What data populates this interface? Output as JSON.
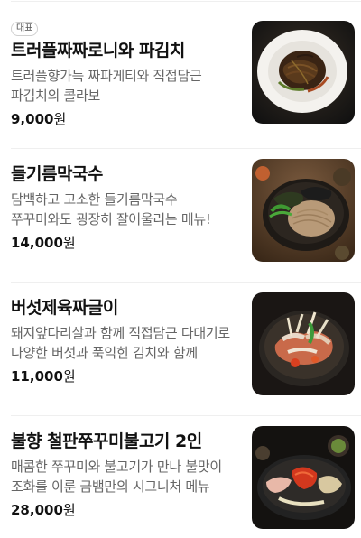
{
  "menu": {
    "items": [
      {
        "badge": "대표",
        "name": "트러플짜짜로니와 파김치",
        "description": "트러플향가득 짜파게티와 직접담근 파김치의 콜라보",
        "price_number": "9,000",
        "price_unit": "원"
      },
      {
        "name": "들기름막국수",
        "description": "담백하고 고소한 들기름막국수 쭈꾸미와도 굉장히 잘어울리는 메뉴!",
        "price_number": "14,000",
        "price_unit": "원"
      },
      {
        "name": "버섯제육짜글이",
        "description": "돼지앞다리살과 함께 직접담근 다대기로 다양한 버섯과 푹익힌 김치와 함께",
        "price_number": "11,000",
        "price_unit": "원"
      },
      {
        "name": "불향 철판쭈꾸미불고기 2인",
        "description": "매콤한 쭈꾸미와 불고기가 만나 불맛이 조화를 이룬 금뱀만의 시그니처 메뉴",
        "price_number": "28,000",
        "price_unit": "원"
      }
    ]
  }
}
